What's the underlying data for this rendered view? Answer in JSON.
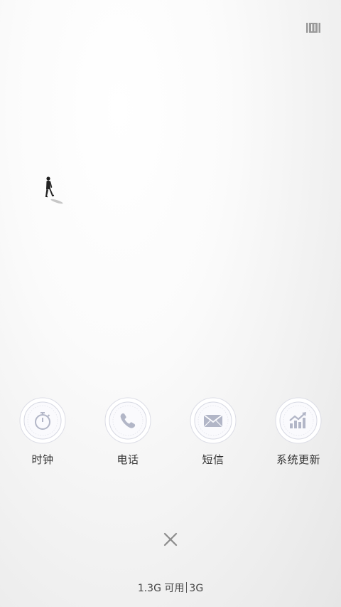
{
  "header": {
    "recents_icon": "recents-grid-icon"
  },
  "wallpaper": {
    "figure": "walking-person"
  },
  "apps": [
    {
      "label": "时钟",
      "icon": "stopwatch-icon"
    },
    {
      "label": "电话",
      "icon": "phone-icon"
    },
    {
      "label": "短信",
      "icon": "envelope-icon"
    },
    {
      "label": "系统更新",
      "icon": "trend-chart-icon"
    }
  ],
  "footer": {
    "close_icon": "close-icon",
    "memory_text": "1.3G 可用",
    "network_text": "3G"
  },
  "colors": {
    "badge_icon": "#b2b6c7",
    "badge_fill": "#fafafd",
    "label": "#333333"
  }
}
